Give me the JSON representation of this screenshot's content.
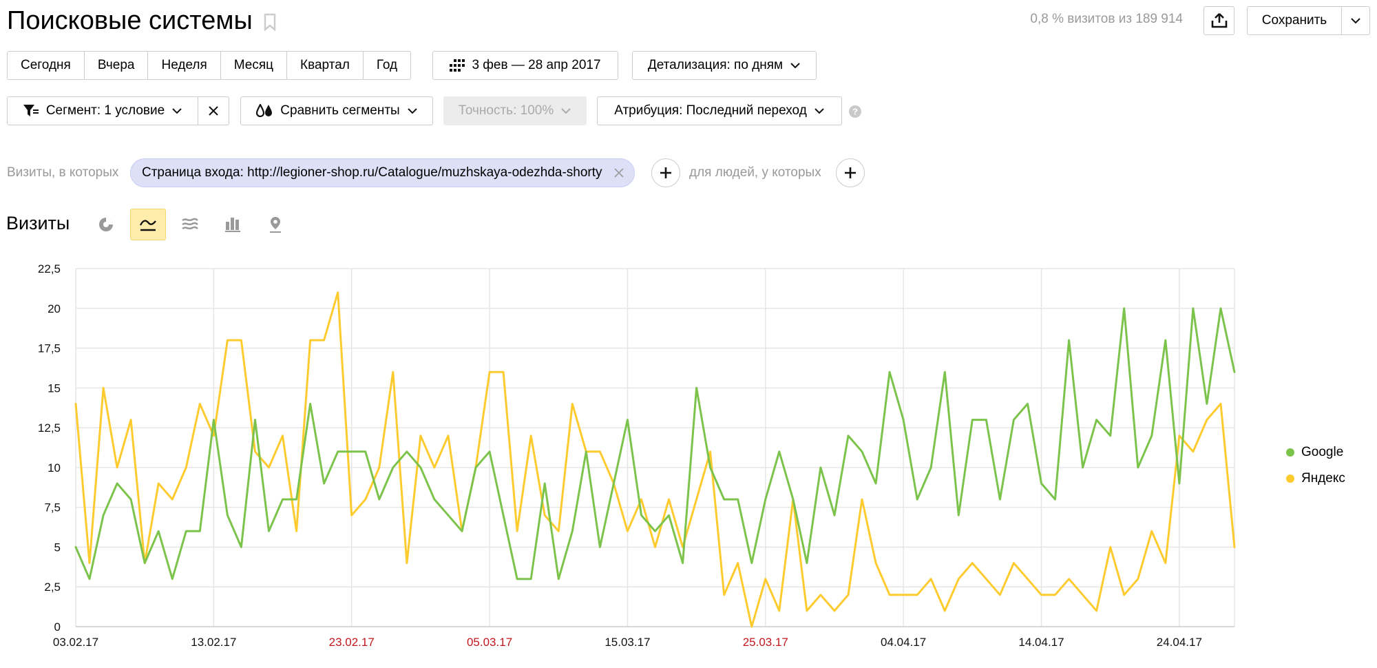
{
  "header": {
    "title": "Поисковые системы",
    "summary": "0,8 % визитов из 189 914",
    "save_label": "Сохранить"
  },
  "period_buttons": [
    "Сегодня",
    "Вчера",
    "Неделя",
    "Месяц",
    "Квартал",
    "Год"
  ],
  "date_range": "3 фев — 28 апр 2017",
  "detail": "Детализация: по дням",
  "segment": "Сегмент: 1 условие",
  "compare": "Сравнить сегменты",
  "accuracy": "Точность: 100%",
  "attribution": "Атрибуция: Последний переход",
  "filter": {
    "visits_label": "Визиты, в которых",
    "chip": "Страница входа: http://legioner-shop.ru/Catalogue/muzhskaya-odezhda-shorty",
    "people_label": "для людей, у которых"
  },
  "section_title": "Визиты",
  "colors": {
    "google": "#7cc34c",
    "yandex": "#fecb2f",
    "holiday_date": "#c0161e"
  },
  "chart_data": {
    "type": "line",
    "y_ticks": [
      "0",
      "2,5",
      "5",
      "7,5",
      "10",
      "12,5",
      "15",
      "17,5",
      "20",
      "22,5"
    ],
    "ylim": [
      0,
      22.5
    ],
    "x_ticks": [
      {
        "label": "03.02.17",
        "index": 0,
        "holiday": false
      },
      {
        "label": "13.02.17",
        "index": 10,
        "holiday": false
      },
      {
        "label": "23.02.17",
        "index": 20,
        "holiday": true
      },
      {
        "label": "05.03.17",
        "index": 30,
        "holiday": true
      },
      {
        "label": "15.03.17",
        "index": 40,
        "holiday": false
      },
      {
        "label": "25.03.17",
        "index": 50,
        "holiday": true
      },
      {
        "label": "04.04.17",
        "index": 60,
        "holiday": false
      },
      {
        "label": "14.04.17",
        "index": 70,
        "holiday": false
      },
      {
        "label": "24.04.17",
        "index": 80,
        "holiday": false
      }
    ],
    "series": [
      {
        "name": "Google",
        "color": "#7cc34c",
        "values": [
          5,
          3,
          7,
          9,
          8,
          4,
          6,
          3,
          6,
          6,
          13,
          7,
          5,
          13,
          6,
          8,
          8,
          14,
          9,
          11,
          11,
          11,
          8,
          10,
          11,
          10,
          8,
          7,
          6,
          10,
          11,
          7,
          3,
          3,
          9,
          3,
          6,
          11,
          5,
          9,
          13,
          7,
          6,
          7,
          4,
          15,
          10,
          8,
          8,
          4,
          8,
          11,
          8,
          4,
          10,
          7,
          12,
          11,
          9,
          16,
          13,
          8,
          10,
          16,
          7,
          13,
          13,
          8,
          13,
          14,
          9,
          8,
          18,
          10,
          13,
          12,
          20,
          10,
          12,
          18,
          9,
          20,
          14,
          20,
          16
        ]
      },
      {
        "name": "Яндекс",
        "color": "#fecb2f",
        "values": [
          14,
          4,
          15,
          10,
          13,
          4,
          9,
          8,
          10,
          14,
          12,
          18,
          18,
          11,
          10,
          12,
          6,
          18,
          18,
          21,
          7,
          8,
          10,
          16,
          4,
          12,
          10,
          12,
          6,
          10,
          16,
          16,
          6,
          12,
          7,
          6,
          14,
          11,
          11,
          9,
          6,
          8,
          5,
          8,
          5,
          8,
          11,
          2,
          4,
          0,
          3,
          1,
          8,
          1,
          2,
          1,
          2,
          8,
          4,
          2,
          2,
          2,
          3,
          1,
          3,
          4,
          3,
          2,
          4,
          3,
          2,
          2,
          3,
          2,
          1,
          5,
          2,
          3,
          6,
          4,
          12,
          11,
          13,
          14,
          5
        ]
      }
    ]
  }
}
